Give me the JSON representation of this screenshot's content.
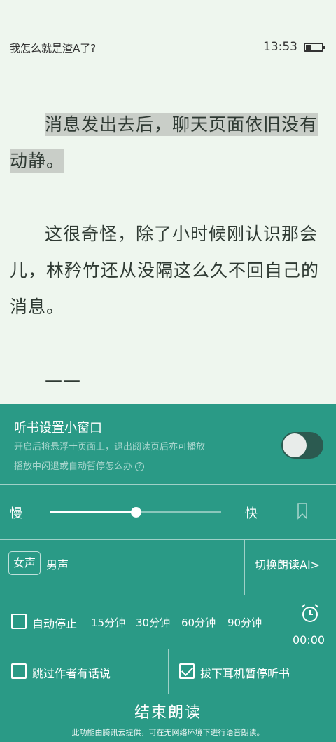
{
  "status": {
    "book_title": "我怎么就是渣A了?",
    "time": "13:53",
    "battery_level": 0.35
  },
  "reader": {
    "paragraphs": [
      "消息发出去后，聊天页面依旧没有动静。",
      "这很奇怪，除了小时候刚认识那会儿，林矜竹还从没隔这么久不回自己的消息。",
      "——"
    ]
  },
  "panel": {
    "floating_window": {
      "title": "听书设置小窗口",
      "desc": "开启后将悬浮于页面上，退出阅读页后亦可播放",
      "help": "播放中闪退或自动暂停怎么办",
      "help_icon": "question-icon",
      "enabled": false
    },
    "speed": {
      "slow_label": "慢",
      "fast_label": "快",
      "value": 0.5,
      "bookmark_icon": "bookmark-icon"
    },
    "voice": {
      "female": "女声",
      "male": "男声",
      "selected": "女声",
      "switch_ai": "切换朗读AI>"
    },
    "auto_stop": {
      "label": "自动停止",
      "checked": false,
      "options": [
        "15分钟",
        "30分钟",
        "60分钟",
        "90分钟"
      ],
      "timer": "00:00",
      "alarm_icon": "alarm-clock-icon"
    },
    "options": {
      "skip_author": "跳过作者有话说",
      "skip_author_checked": false,
      "unplug_pause": "拔下耳机暂停听书",
      "unplug_pause_checked": true
    },
    "end_button": "结束朗读",
    "footnote": "此功能由腾讯云提供，可在无网络环境下进行语音朗读。"
  },
  "colors": {
    "page_bg": "#eef6ee",
    "panel_bg": "#2a9a86",
    "highlight": "#c9cec8",
    "toggle_off": "#2b5a50"
  }
}
